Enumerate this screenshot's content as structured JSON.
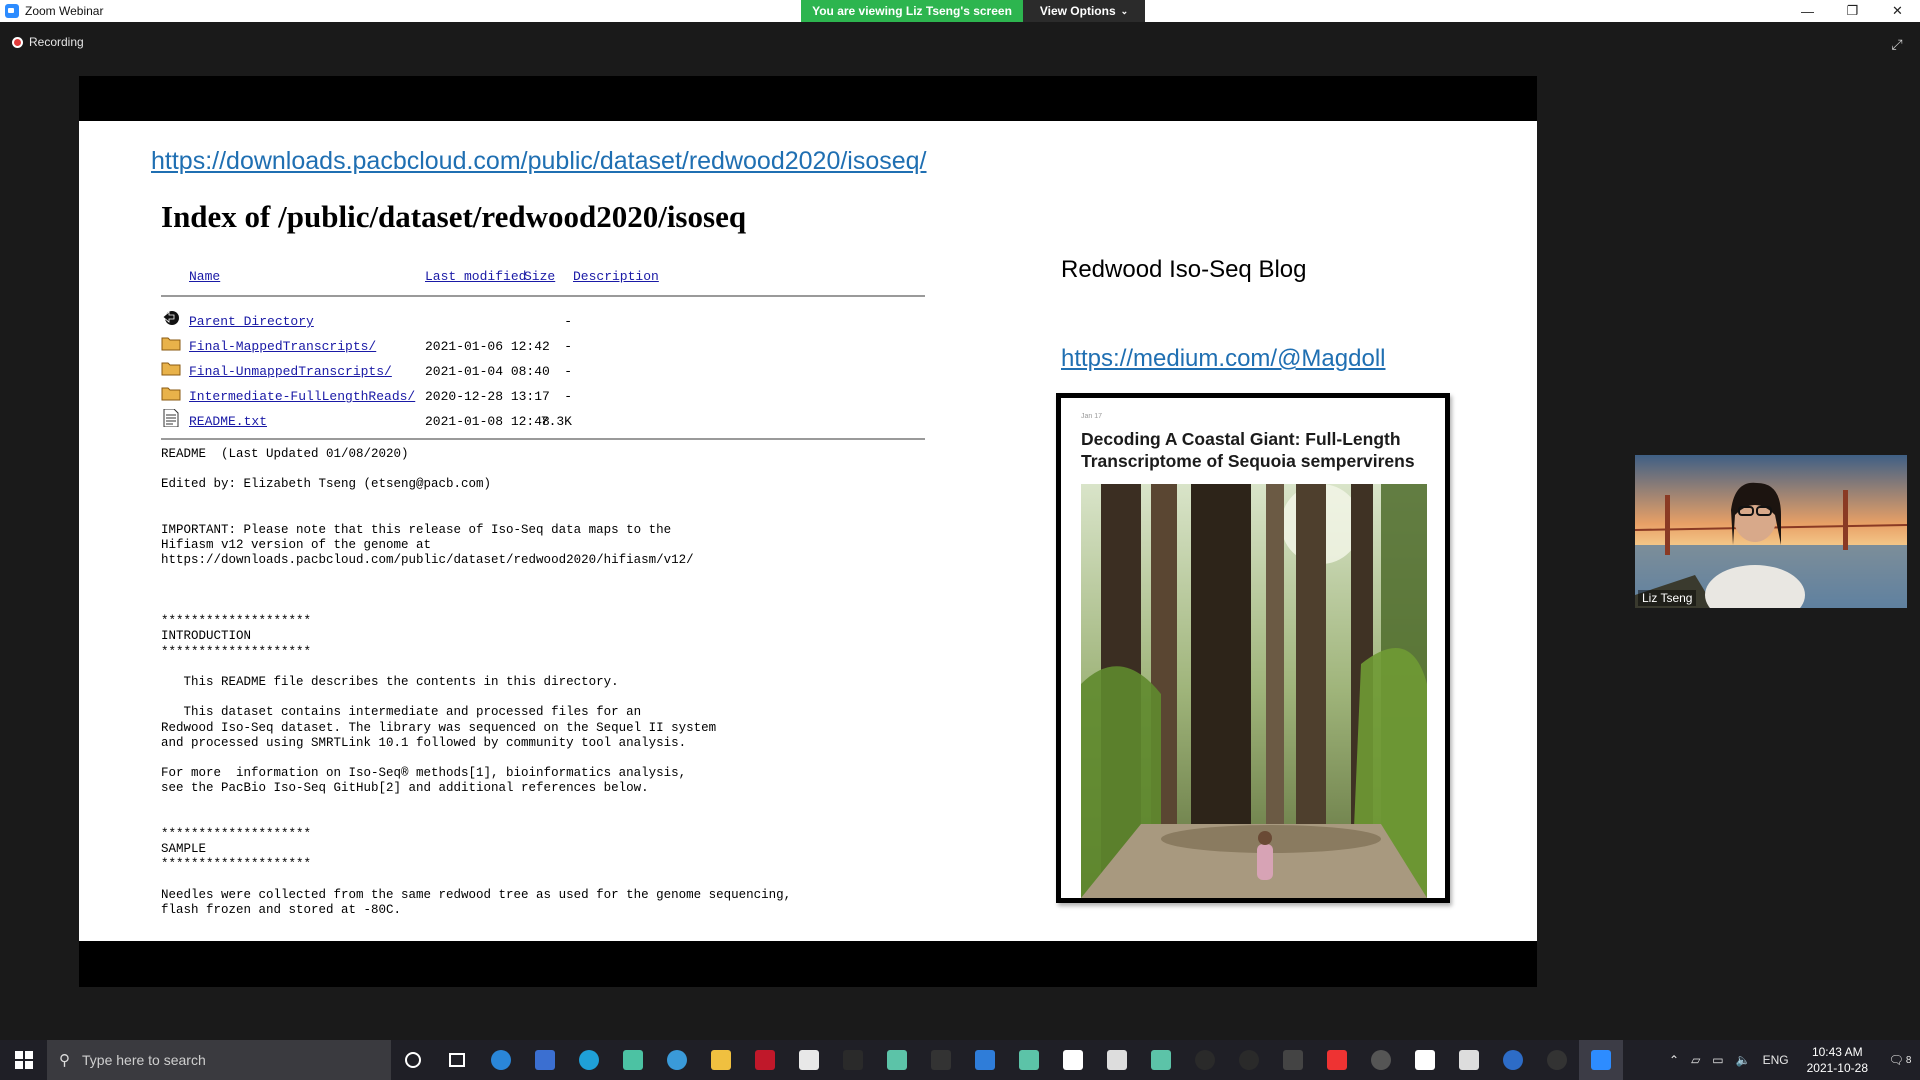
{
  "titlebar": {
    "app_title": "Zoom Webinar",
    "viewing_banner": "You are viewing Liz Tseng's screen",
    "view_options": "View Options",
    "minimize": "—",
    "maximize": "❐",
    "close": "✕"
  },
  "recording": {
    "label": "Recording"
  },
  "slide": {
    "url": "https://downloads.pacbcloud.com/public/dataset/redwood2020/isoseq/",
    "index_title": "Index of /public/dataset/redwood2020/isoseq",
    "columns": {
      "name": "Name",
      "last_modified": "Last modified",
      "size": "Size",
      "description": "Description"
    },
    "rows": [
      {
        "name": "Parent Directory",
        "modified": "",
        "size": "-",
        "icon": "back-icon"
      },
      {
        "name": "Final-MappedTranscripts/",
        "modified": "2021-01-06 12:42",
        "size": "-",
        "icon": "folder-icon"
      },
      {
        "name": "Final-UnmappedTranscripts/",
        "modified": "2021-01-04 08:40",
        "size": "-",
        "icon": "folder-icon"
      },
      {
        "name": "Intermediate-FullLengthReads/",
        "modified": "2020-12-28 13:17",
        "size": "-",
        "icon": "folder-icon"
      },
      {
        "name": "README.txt",
        "modified": "2021-01-08 12:48",
        "size": "7.3K",
        "icon": "text-file-icon"
      }
    ],
    "readme_text": "README  (Last Updated 01/08/2020)\n\nEdited by: Elizabeth Tseng (etseng@pacb.com)\n\n\nIMPORTANT: Please note that this release of Iso-Seq data maps to the\nHifiasm v12 version of the genome at\nhttps://downloads.pacbcloud.com/public/dataset/redwood2020/hifiasm/v12/\n\n\n\n********************\nINTRODUCTION\n********************\n\n   This README file describes the contents in this directory.\n\n   This dataset contains intermediate and processed files for an\nRedwood Iso-Seq dataset. The library was sequenced on the Sequel II system\nand processed using SMRTLink 10.1 followed by community tool analysis.\n\nFor more  information on Iso-Seq® methods[1], bioinformatics analysis,\nsee the PacBio Iso-Seq GitHub[2] and additional references below.\n\n\n********************\nSAMPLE\n********************\n\nNeedles were collected from the same redwood tree as used for the genome sequencing,\nflash frozen and stored at -80C.",
    "blog_title": "Redwood Iso-Seq Blog",
    "blog_link": "https://medium.com/@Magdoll",
    "card": {
      "date": "Jan 17",
      "title": "Decoding A Coastal Giant: Full-Length Transcriptome of Sequoia sempervirens"
    }
  },
  "webcam": {
    "participant": "Liz Tseng"
  },
  "taskbar": {
    "search_placeholder": "Type here to search",
    "language": "ENG",
    "time": "10:43 AM",
    "date": "2021-10-28",
    "notifications": "8"
  },
  "colors": {
    "banner_green": "#2db54f",
    "link_blue": "#1f6fb2",
    "taskbar": "#1f1f26"
  }
}
